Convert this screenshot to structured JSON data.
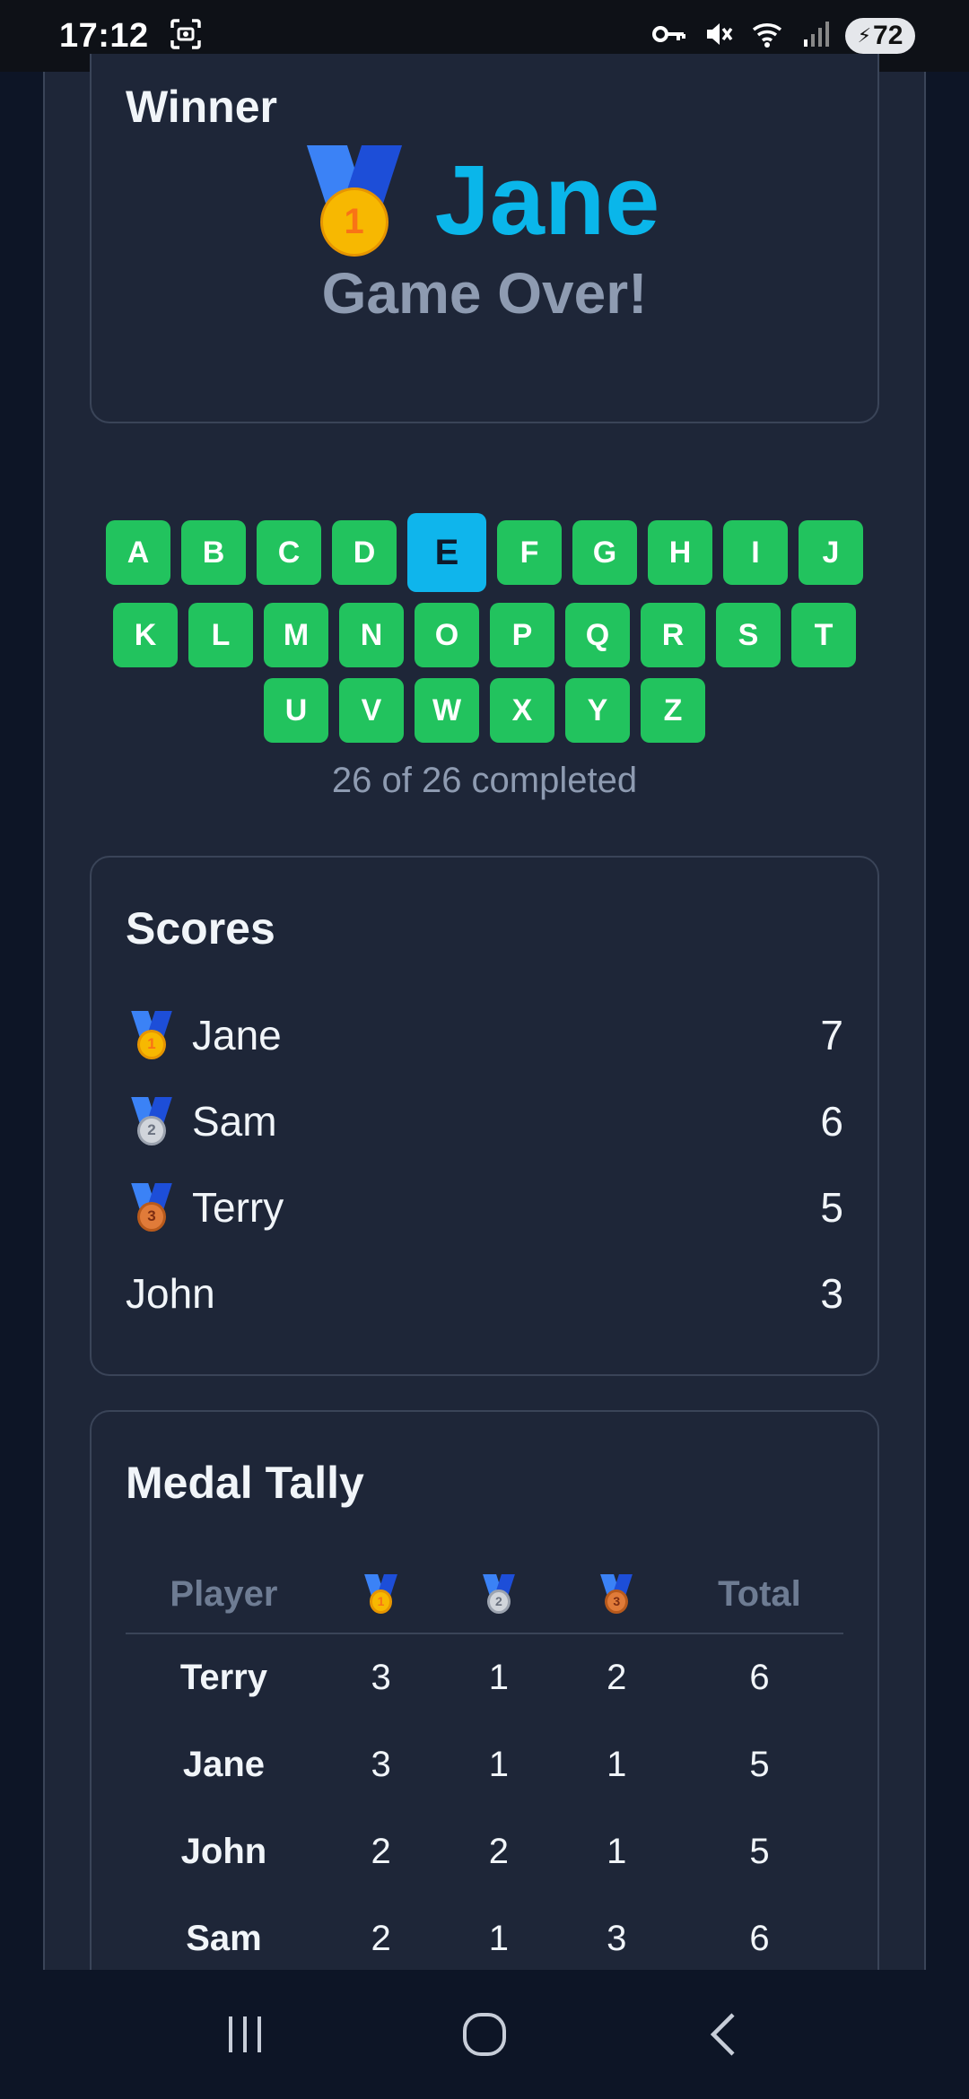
{
  "status_bar": {
    "time": "17:12",
    "battery": "72",
    "icons": [
      "screenshot-icon",
      "vpn-key-icon",
      "mute-icon",
      "wifi-icon",
      "signal-icon",
      "battery-icon"
    ]
  },
  "winner": {
    "title": "Winner",
    "name": "Jane",
    "medal": "1",
    "status": "Game Over!"
  },
  "letters": {
    "rows": [
      [
        "A",
        "B",
        "C",
        "D",
        "E",
        "F",
        "G",
        "H",
        "I",
        "J"
      ],
      [
        "K",
        "L",
        "M",
        "N",
        "O",
        "P",
        "Q",
        "R",
        "S",
        "T"
      ],
      [
        "U",
        "V",
        "W",
        "X",
        "Y",
        "Z"
      ]
    ],
    "active": "E",
    "completed_text": "26 of 26 completed"
  },
  "scores": {
    "title": "Scores",
    "rows": [
      {
        "name": "Jane",
        "score": "7",
        "medal": "1"
      },
      {
        "name": "Sam",
        "score": "6",
        "medal": "2"
      },
      {
        "name": "Terry",
        "score": "5",
        "medal": "3"
      },
      {
        "name": "John",
        "score": "3",
        "medal": ""
      }
    ]
  },
  "medal_tally": {
    "title": "Medal Tally",
    "headers": {
      "player": "Player",
      "gold": "1",
      "silver": "2",
      "bronze": "3",
      "total": "Total"
    },
    "rows": [
      {
        "player": "Terry",
        "gold": "3",
        "silver": "1",
        "bronze": "2",
        "total": "6"
      },
      {
        "player": "Jane",
        "gold": "3",
        "silver": "1",
        "bronze": "1",
        "total": "5"
      },
      {
        "player": "John",
        "gold": "2",
        "silver": "2",
        "bronze": "1",
        "total": "5"
      },
      {
        "player": "Sam",
        "gold": "2",
        "silver": "1",
        "bronze": "3",
        "total": "6"
      }
    ]
  },
  "colors": {
    "accent": "#0ab6ea",
    "letter_done": "#22c35e",
    "background": "#1e2638"
  }
}
